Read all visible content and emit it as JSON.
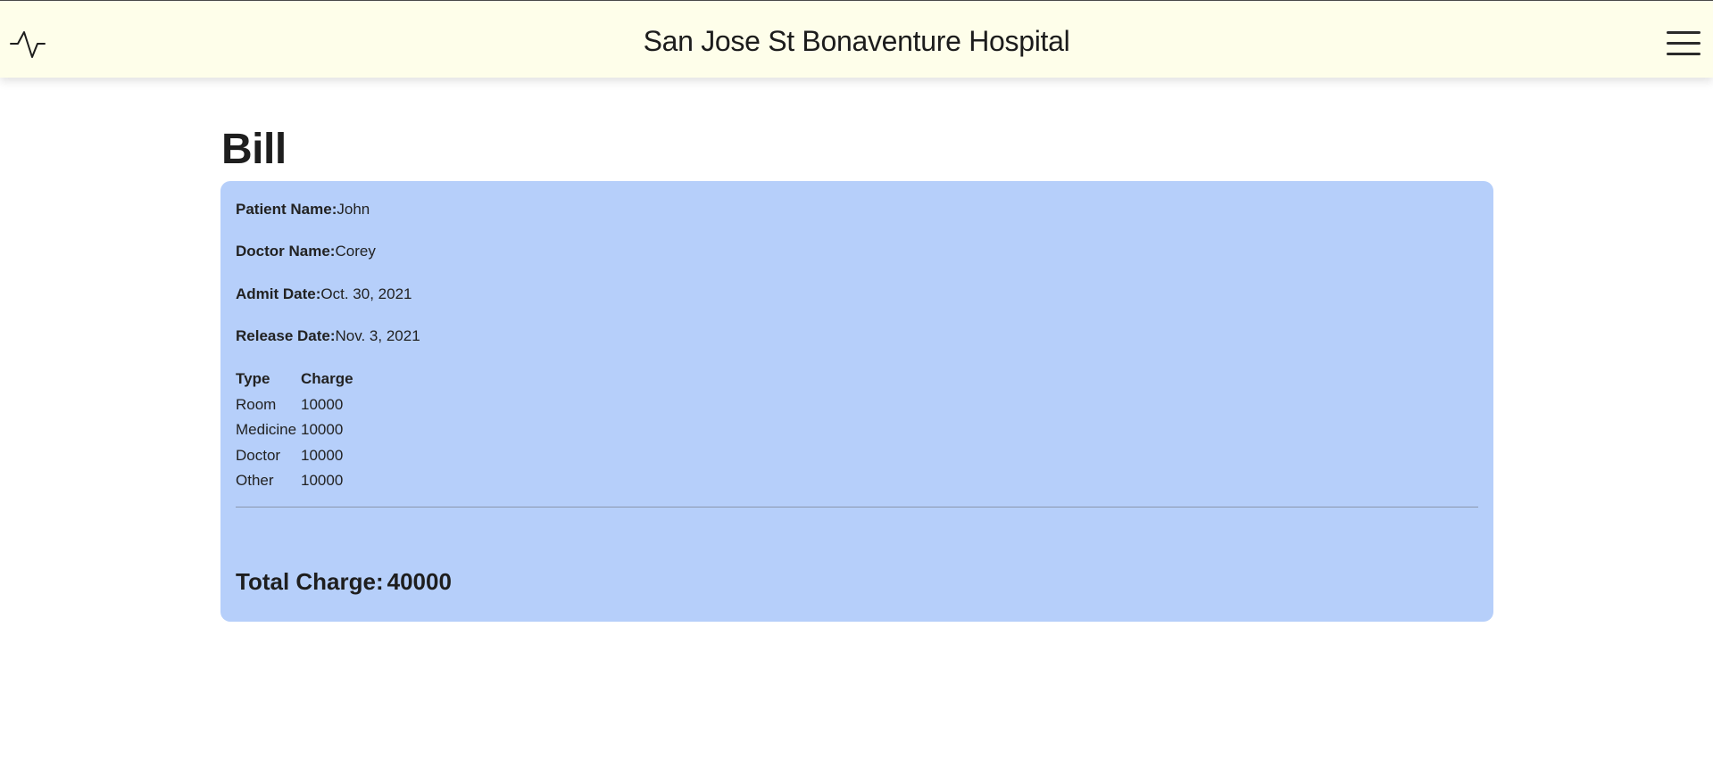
{
  "header": {
    "title": "San Jose St Bonaventure Hospital",
    "logo_icon": "pulse-icon",
    "menu_icon": "hamburger-menu-icon",
    "background": "#fefeea"
  },
  "page": {
    "heading": "Bill"
  },
  "bill": {
    "card_color": "#b6cffa",
    "patient_name_label": "Patient Name:",
    "patient_name": "John",
    "doctor_name_label": "Doctor Name:",
    "doctor_name": "Corey",
    "admit_date_label": "Admit Date:",
    "admit_date": "Oct. 30, 2021",
    "release_date_label": "Release Date:",
    "release_date": "Nov. 3, 2021",
    "table": {
      "headers": [
        "Type",
        "Charge"
      ],
      "rows": [
        {
          "type": "Room",
          "charge": "10000"
        },
        {
          "type": "Medicine",
          "charge": "10000"
        },
        {
          "type": "Doctor",
          "charge": "10000"
        },
        {
          "type": "Other",
          "charge": "10000"
        }
      ]
    },
    "total_label": "Total Charge:",
    "total_value": "40000"
  }
}
